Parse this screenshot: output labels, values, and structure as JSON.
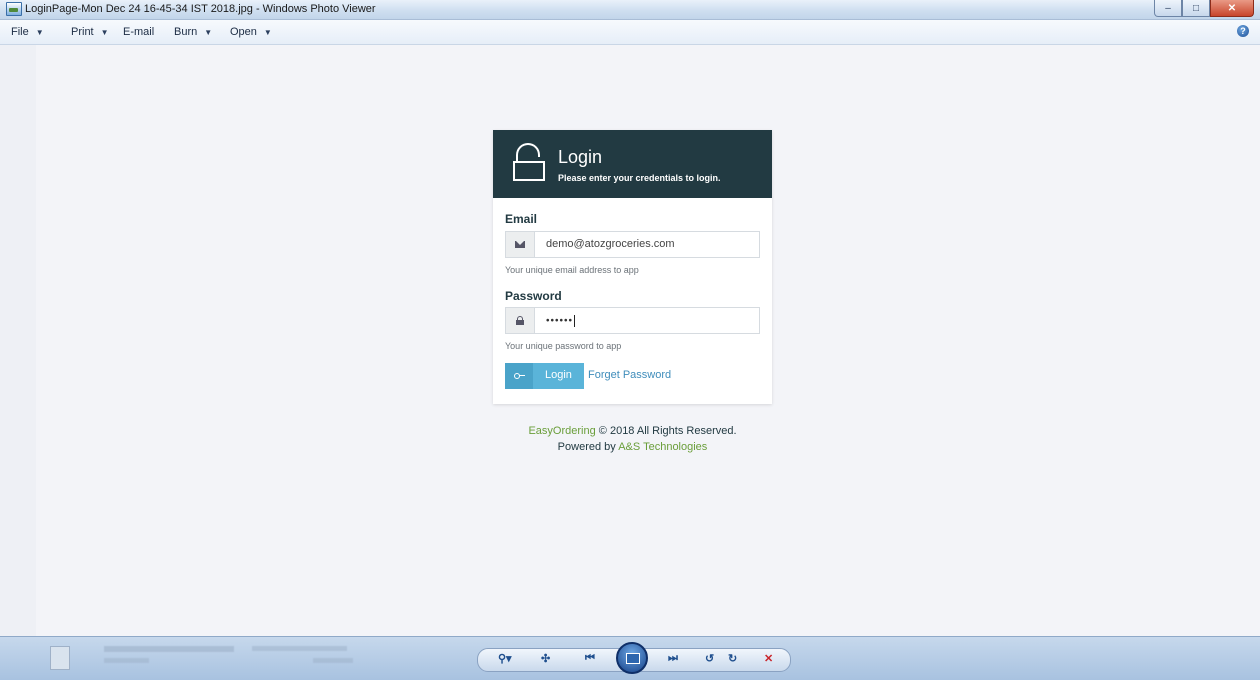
{
  "window": {
    "title": "LoginPage-Mon Dec 24 16-45-34 IST 2018.jpg - Windows Photo Viewer",
    "controls": [
      "minimize",
      "maximize",
      "close"
    ]
  },
  "menubar": {
    "items": [
      {
        "label": "File",
        "dropdown": true
      },
      {
        "label": "Print",
        "dropdown": true
      },
      {
        "label": "E-mail",
        "dropdown": false
      },
      {
        "label": "Burn",
        "dropdown": true
      },
      {
        "label": "Open",
        "dropdown": true
      }
    ],
    "help_icon": "help-icon"
  },
  "login": {
    "title": "Login",
    "subtitle": "Please enter your credentials to login.",
    "email": {
      "label": "Email",
      "value": "demo@atozgroceries.com",
      "help": "Your unique email address to app",
      "icon": "envelope-icon"
    },
    "password": {
      "label": "Password",
      "value": "••••••",
      "help": "Your unique password to app",
      "icon": "lock-icon"
    },
    "login_button": "Login",
    "forget_link": "Forget Password",
    "colors": {
      "header": "#223a42",
      "button": "#5ab4d9",
      "link": "#3f8dbb",
      "accent": "#6a9e3a"
    }
  },
  "footer": {
    "brand": "EasyOrdering",
    "copyright": "© 2018 All Rights Reserved.",
    "powered_by": "Powered by",
    "company": "A&S Technologies"
  }
}
